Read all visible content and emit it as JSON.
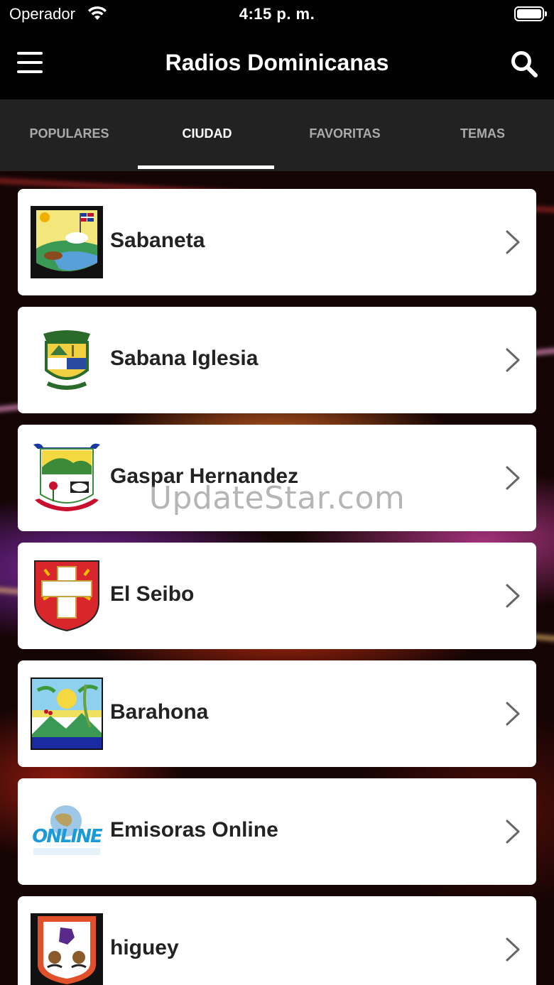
{
  "status_bar": {
    "carrier": "Operador",
    "time": "4:15 p. m."
  },
  "nav": {
    "title": "Radios Dominicanas"
  },
  "tabs": [
    {
      "label": "POPULARES",
      "active": false
    },
    {
      "label": "CIUDAD",
      "active": true
    },
    {
      "label": "FAVORITAS",
      "active": false
    },
    {
      "label": "TEMAS",
      "active": false
    }
  ],
  "cities": [
    {
      "name": "Sabaneta",
      "icon": "sabaneta-crest-icon"
    },
    {
      "name": "Sabana Iglesia",
      "icon": "sabana-iglesia-crest-icon"
    },
    {
      "name": "Gaspar Hernandez",
      "icon": "gaspar-hernandez-crest-icon"
    },
    {
      "name": "El Seibo",
      "icon": "el-seibo-crest-icon"
    },
    {
      "name": "Barahona",
      "icon": "barahona-crest-icon"
    },
    {
      "name": "Emisoras Online",
      "icon": "online-globe-icon"
    },
    {
      "name": "higuey",
      "icon": "higuey-crest-icon"
    }
  ],
  "watermark": "UpdateStar.com",
  "colors": {
    "nav_bg": "#000000",
    "tab_bg": "#222222",
    "card_bg": "#ffffff",
    "text": "#222222"
  }
}
